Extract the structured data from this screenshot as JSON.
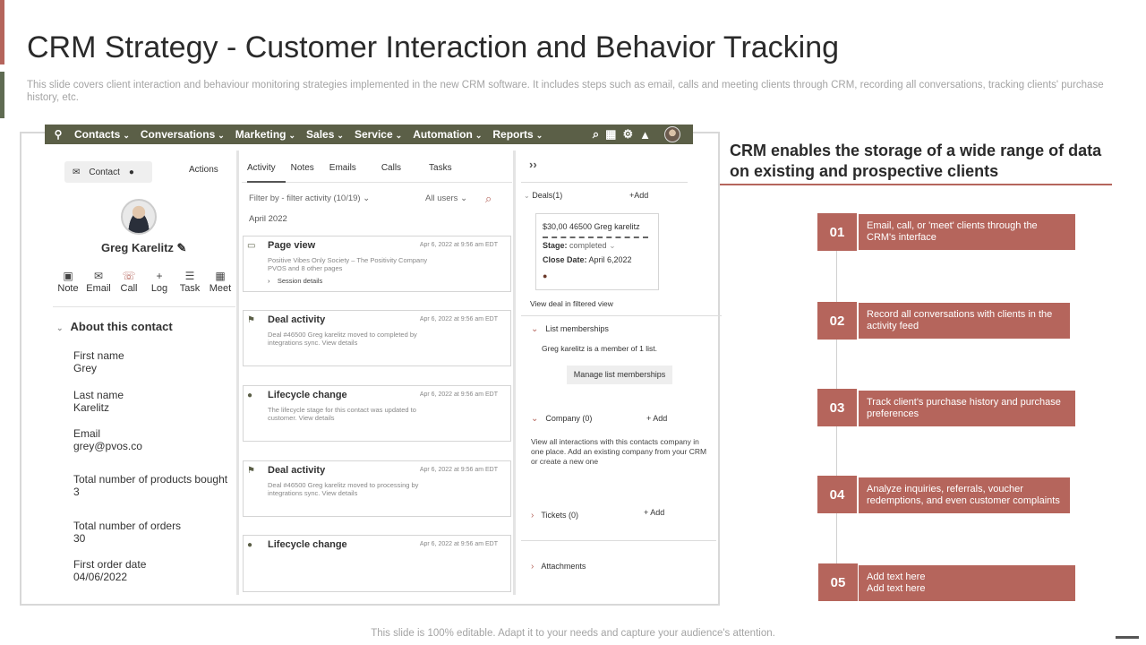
{
  "slide": {
    "title": "CRM Strategy - Customer Interaction and Behavior Tracking",
    "subtitle": "This slide covers client interaction and behaviour monitoring strategies implemented in the new CRM software. It includes steps such as email, calls and meeting clients through CRM, recording all conversations, tracking clients' purchase history, etc.",
    "footer": "This slide is 100% editable. Adapt it to your needs and capture your audience's attention."
  },
  "colors": {
    "accent": "#b5655c",
    "nav": "#5b5f47",
    "accent_secondary": "#5f6b52"
  },
  "crm": {
    "nav": [
      "Contacts",
      "Conversations",
      "Marketing",
      "Sales",
      "Service",
      "Automation",
      "Reports"
    ],
    "contact_chip": "Contact",
    "actions_label": "Actions",
    "contact_name": "Greg Karelitz",
    "quick_actions": [
      {
        "label": "Note",
        "icon": "note-icon"
      },
      {
        "label": "Email",
        "icon": "email-icon"
      },
      {
        "label": "Call",
        "icon": "call-icon"
      },
      {
        "label": "Log",
        "icon": "log-icon"
      },
      {
        "label": "Task",
        "icon": "task-icon"
      },
      {
        "label": "Meet",
        "icon": "meet-icon"
      }
    ],
    "about_heading": "About this contact",
    "fields": [
      {
        "label": "First name",
        "value": "Grey"
      },
      {
        "label": "Last name",
        "value": "Karelitz"
      },
      {
        "label": "Email",
        "value": "grey@pvos.co"
      },
      {
        "label": "Total number of products bought",
        "value": "3"
      },
      {
        "label": "Total number of orders",
        "value": "30"
      },
      {
        "label": "First order date",
        "value": "04/06/2022"
      }
    ],
    "tabs": [
      "Activity",
      "Notes",
      "Emails",
      "Calls",
      "Tasks"
    ],
    "filter_label": "Filter by -  filter activity (10/19)",
    "users_label": "All users",
    "month": "April 2022",
    "cards": [
      {
        "title": "Page view",
        "time": "Apr 6, 2022 at 9:56 am EDT",
        "body": "Positive Vibes  Only Society  – The Positivity Company PVOS and  8 other pages",
        "sub": "Session details"
      },
      {
        "title": "Deal activity",
        "time": "Apr 6, 2022 at 9:56 am EDT",
        "body": "Deal  #46500  Greg karelitz  moved to completed by integrations  sync.  View details"
      },
      {
        "title": "Lifecycle change",
        "time": "Apr 6, 2022 at 9:56 am EDT",
        "body": "The lifecycle stage  for this contact  was updated  to customer.  View details"
      },
      {
        "title": "Deal activity",
        "time": "Apr 6, 2022 at 9:56 am EDT",
        "body": "Deal  #46500  Greg karelitz  moved to processing by integrations  sync.  View details"
      },
      {
        "title": "Lifecycle change",
        "time": "Apr 6, 2022 at 9:56 am EDT",
        "body": ""
      }
    ],
    "deals": {
      "header": "Deals(1)",
      "add": "+Add",
      "amount": "$30,00  46500  Greg karelitz",
      "stage": "Stage:",
      "stage_value": "completed",
      "close_label": "Close Date:",
      "close_value": "April 6,2022",
      "view_link": "View deal in filtered view"
    },
    "lists": {
      "header": "List memberships",
      "text": "Greg karelitz  is a member of 1 list.",
      "button": "Manage  list memberships"
    },
    "company": {
      "header": "Company (0)",
      "add": "+ Add",
      "text": "View all interactions with this contacts company in one place. Add an existing company from your CRM or create a new one"
    },
    "tickets": {
      "header": "Tickets (0)",
      "add": "+ Add"
    },
    "attachments": "Attachments"
  },
  "right_side": {
    "heading": "CRM enables the storage of a wide range of data on existing and prospective clients",
    "steps": [
      {
        "num": "01",
        "text": "Email,  call,  or 'meet'  clients through the CRM's  interface"
      },
      {
        "num": "02",
        "text": "Record all conversations with clients in the activity feed"
      },
      {
        "num": "03",
        "text": "Track client's purchase history and purchase preferences"
      },
      {
        "num": "04",
        "text": "Analyze inquiries, referrals, voucher redemptions, and even customer complaints"
      },
      {
        "num": "05",
        "text": "Add text here\nAdd text here"
      }
    ]
  }
}
